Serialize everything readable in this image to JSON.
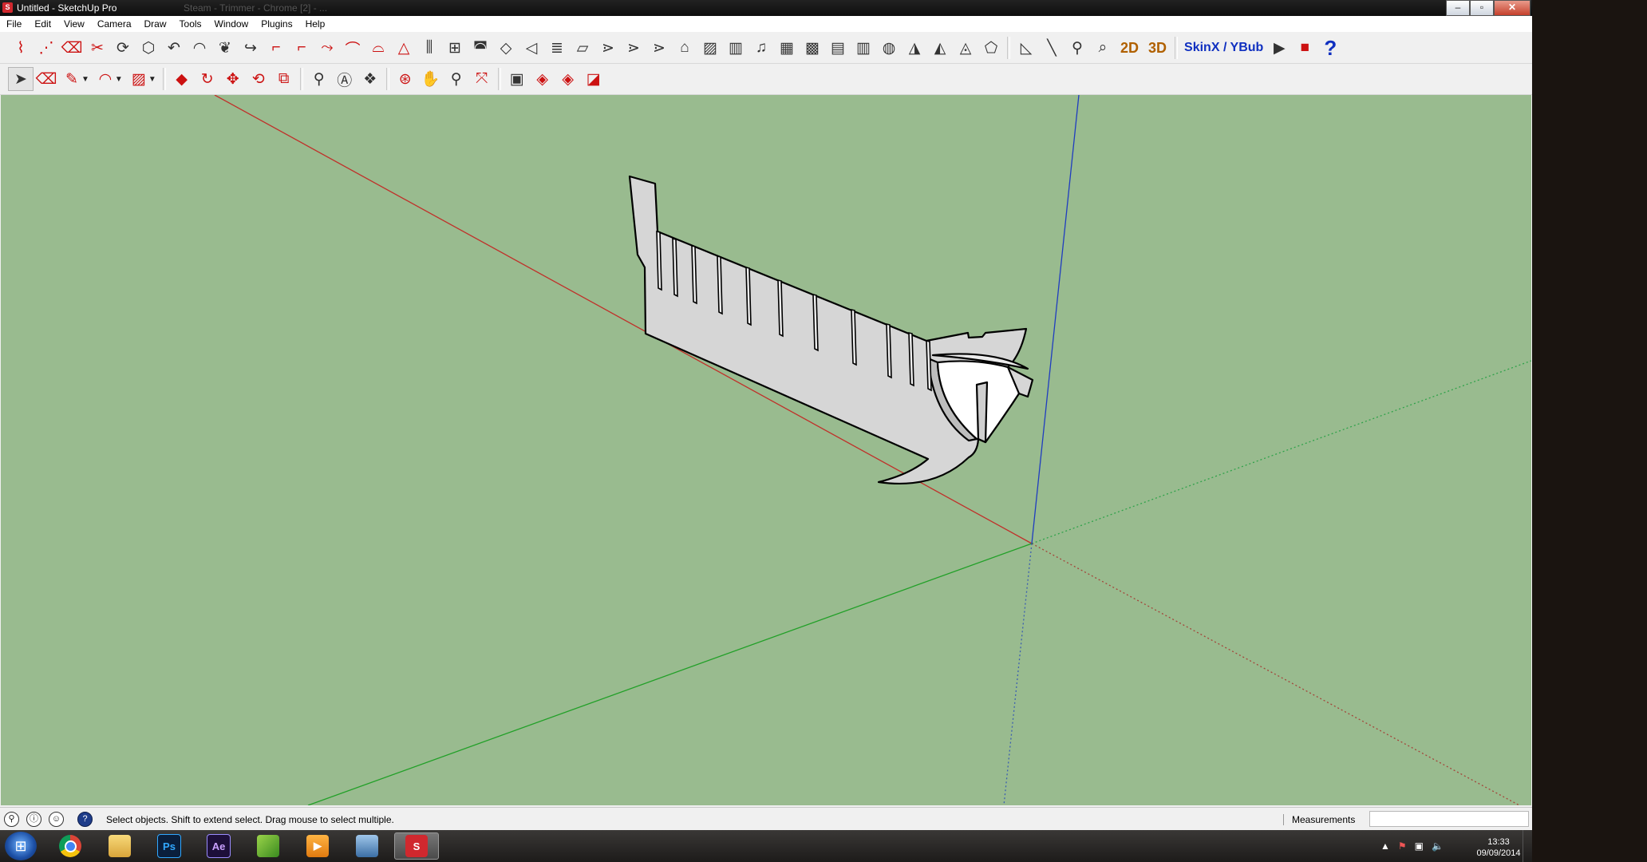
{
  "window": {
    "title": "Untitled - SketchUp Pro",
    "ghost_title": "Steam - Trimmer - Chrome [2] - ..."
  },
  "window_buttons": {
    "minimize": "–",
    "restore": "▫",
    "close": "✕"
  },
  "menu": [
    "File",
    "Edit",
    "View",
    "Camera",
    "Draw",
    "Tools",
    "Window",
    "Plugins",
    "Help"
  ],
  "toolbar1": {
    "icons": [
      "bezier-icon",
      "polyline-icon",
      "eraser-curve-icon",
      "cut-icon",
      "offset-icon",
      "shape-icon",
      "bend-icon",
      "loft-icon",
      "extrude-icon",
      "follow-icon",
      "corner-icon",
      "corner2-icon",
      "weld-icon",
      "skin-icon",
      "arch-icon",
      "cone-icon",
      "tube-icon",
      "lathe-icon",
      "dome-icon",
      "sweep-icon",
      "arrow-icon",
      "stair-icon",
      "plane-icon",
      "rail-icon",
      "rail2-icon",
      "rail3-icon",
      "bridge-icon",
      "wall-icon",
      "fence-icon",
      "grid-icon",
      "hatch-icon",
      "hatch2-icon",
      "hatch3-icon",
      "cage-icon",
      "mesh-icon",
      "wedge-icon",
      "ring-icon",
      "sphere-icon"
    ],
    "text_2d": "2D",
    "text_3d": "3D",
    "skinx_label": "SkinX / YBub"
  },
  "toolbar2": {
    "icons": [
      "select-icon",
      "eraser-icon",
      "pencil-icon",
      "arc-icon",
      "rectangle-icon",
      "pushpull-icon",
      "followme-icon",
      "move-icon",
      "rotate-icon",
      "scale-icon",
      "tape-icon",
      "text-icon",
      "paint-icon",
      "orbit-icon",
      "pan-icon",
      "zoom-icon",
      "zoom-extents-icon",
      "warehouse-icon",
      "components-icon",
      "styles-icon",
      "layers-icon"
    ]
  },
  "status": {
    "text": "Select objects. Shift to extend select. Drag mouse to select multiple.",
    "measurements_label": "Measurements",
    "measurements_value": ""
  },
  "taskbar": {
    "apps": [
      "chrome-icon",
      "explorer-icon",
      "photoshop-icon",
      "after-effects-icon",
      "sketch-icon",
      "media-player-icon",
      "remote-icon",
      "sketchup-icon"
    ],
    "ps_label": "Ps",
    "ae_label": "Ae",
    "clock_time": "13:33",
    "clock_date": "09/09/2014"
  },
  "colors": {
    "viewport": "#99bb8f",
    "axis_red": "#c0302a",
    "axis_green": "#22a028",
    "axis_blue": "#1f3cc0",
    "model_face": "#d6d6d6"
  }
}
